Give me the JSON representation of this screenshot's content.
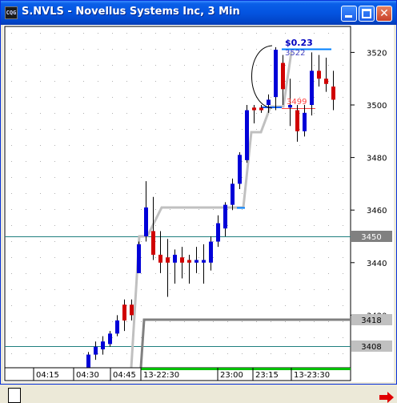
{
  "window": {
    "app_icon_text": "CQG",
    "title": "S.NVLS - Novellus Systems Inc, 3 Min",
    "minimize_icon": "minimize-icon",
    "maximize_icon": "maximize-icon",
    "close_icon": "close-icon"
  },
  "colors": {
    "up_candle": "#0000d8",
    "down_candle": "#d00000",
    "gray_line": "#c0c0c0",
    "dark_gray_line": "#808080",
    "teal_line": "#208080",
    "blue_level": "#0080ff",
    "green_bar": "#00c000"
  },
  "annotation": {
    "change": "$0.23",
    "high_price": "3522",
    "low_price": "3499"
  },
  "price_labels": {
    "ticks": [
      "3520",
      "3500",
      "3480",
      "3460",
      "3440",
      "3420"
    ],
    "highlight_3450": "3450",
    "highlight_3418": "3418",
    "highlight_3408": "3408"
  },
  "time_labels": [
    "04:15",
    "04:30",
    "04:45",
    "13-22:30",
    "23:00",
    "23:15",
    "13-23:30"
  ],
  "chart_data": {
    "type": "candlestick",
    "ylim": [
      3400,
      3530
    ],
    "candles": [
      {
        "o": 3400,
        "h": 3406,
        "l": 3400,
        "c": 3405,
        "dir": "up"
      },
      {
        "o": 3405,
        "h": 3410,
        "l": 3403,
        "c": 3408,
        "dir": "up"
      },
      {
        "o": 3407,
        "h": 3412,
        "l": 3405,
        "c": 3410,
        "dir": "up"
      },
      {
        "o": 3409,
        "h": 3414,
        "l": 3408,
        "c": 3413,
        "dir": "up"
      },
      {
        "o": 3413,
        "h": 3420,
        "l": 3412,
        "c": 3418,
        "dir": "up"
      },
      {
        "o": 3424,
        "h": 3426,
        "l": 3414,
        "c": 3418,
        "dir": "down"
      },
      {
        "o": 3424,
        "h": 3426,
        "l": 3418,
        "c": 3420,
        "dir": "down"
      },
      {
        "o": 3436,
        "h": 3448,
        "l": 3436,
        "c": 3447,
        "dir": "up"
      },
      {
        "o": 3450,
        "h": 3471,
        "l": 3448,
        "c": 3461,
        "dir": "up"
      },
      {
        "o": 3452,
        "h": 3465,
        "l": 3441,
        "c": 3443,
        "dir": "down"
      },
      {
        "o": 3443,
        "h": 3452,
        "l": 3436,
        "c": 3440,
        "dir": "down"
      },
      {
        "o": 3442,
        "h": 3449,
        "l": 3427,
        "c": 3440,
        "dir": "down"
      },
      {
        "o": 3440,
        "h": 3445,
        "l": 3432,
        "c": 3443,
        "dir": "up"
      },
      {
        "o": 3442,
        "h": 3446,
        "l": 3434,
        "c": 3440,
        "dir": "down"
      },
      {
        "o": 3441,
        "h": 3443,
        "l": 3432,
        "c": 3440,
        "dir": "down"
      },
      {
        "o": 3440,
        "h": 3446,
        "l": 3436,
        "c": 3441,
        "dir": "up"
      },
      {
        "o": 3440,
        "h": 3447,
        "l": 3432,
        "c": 3441,
        "dir": "up"
      },
      {
        "o": 3440,
        "h": 3450,
        "l": 3437,
        "c": 3448,
        "dir": "up"
      },
      {
        "o": 3448,
        "h": 3458,
        "l": 3446,
        "c": 3455,
        "dir": "up"
      },
      {
        "o": 3453,
        "h": 3463,
        "l": 3450,
        "c": 3462,
        "dir": "up"
      },
      {
        "o": 3462,
        "h": 3472,
        "l": 3460,
        "c": 3470,
        "dir": "up"
      },
      {
        "o": 3470,
        "h": 3482,
        "l": 3468,
        "c": 3481,
        "dir": "up"
      },
      {
        "o": 3479,
        "h": 3500,
        "l": 3478,
        "c": 3498,
        "dir": "up"
      },
      {
        "o": 3499,
        "h": 3500,
        "l": 3493,
        "c": 3498,
        "dir": "down"
      },
      {
        "o": 3499,
        "h": 3500,
        "l": 3497,
        "c": 3498,
        "dir": "down"
      },
      {
        "o": 3500,
        "h": 3504,
        "l": 3497,
        "c": 3502,
        "dir": "up"
      },
      {
        "o": 3503,
        "h": 3522,
        "l": 3498,
        "c": 3521,
        "dir": "up"
      },
      {
        "o": 3516,
        "h": 3519,
        "l": 3500,
        "c": 3506,
        "dir": "down"
      },
      {
        "o": 3499,
        "h": 3510,
        "l": 3492,
        "c": 3500,
        "dir": "up"
      },
      {
        "o": 3498,
        "h": 3500,
        "l": 3486,
        "c": 3490,
        "dir": "down"
      },
      {
        "o": 3490,
        "h": 3500,
        "l": 3488,
        "c": 3497,
        "dir": "up"
      },
      {
        "o": 3500,
        "h": 3520,
        "l": 3496,
        "c": 3513,
        "dir": "up"
      },
      {
        "o": 3513,
        "h": 3519,
        "l": 3507,
        "c": 3510,
        "dir": "down"
      },
      {
        "o": 3510,
        "h": 3518,
        "l": 3505,
        "c": 3508,
        "dir": "down"
      },
      {
        "o": 3507,
        "h": 3513,
        "l": 3498,
        "c": 3502,
        "dir": "down"
      }
    ]
  }
}
